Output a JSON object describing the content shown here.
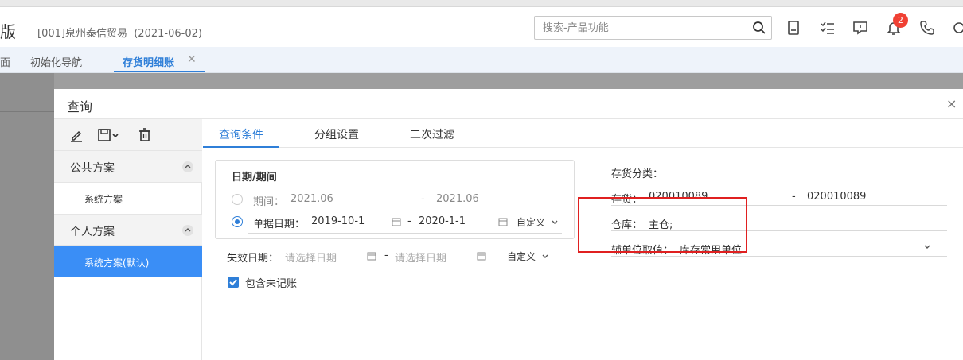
{
  "header": {
    "logo": "版",
    "company": "[001]泉州泰信贸易",
    "date": "(2021-06-02)",
    "search_placeholder": "搜索-产品功能",
    "notification_count": "2"
  },
  "tabs": [
    {
      "label": "面"
    },
    {
      "label": "初始化导航"
    },
    {
      "label": "存货明细账",
      "active": true
    }
  ],
  "dialog": {
    "title": "查询",
    "close": "×",
    "tabs": [
      {
        "label": "查询条件",
        "active": true
      },
      {
        "label": "分组设置"
      },
      {
        "label": "二次过滤"
      }
    ]
  },
  "sidebar": {
    "groups": [
      {
        "label": "公共方案",
        "items": [
          "系统方案"
        ]
      },
      {
        "label": "个人方案",
        "items": [
          "系统方案(默认)"
        ]
      }
    ]
  },
  "date_section": {
    "title": "日期/期间",
    "period_label": "期间：",
    "period_from": "2021.06",
    "period_sep": "-",
    "period_to": "2021.06",
    "doc_date_label": "单据日期：",
    "doc_date_from": "2019-10-1",
    "doc_date_sep": "-",
    "doc_date_to": "2020-1-1",
    "custom_label": "自定义",
    "period_mode": "单据日期"
  },
  "expire": {
    "label": "失效日期：",
    "from_placeholder": "请选择日期",
    "sep": "-",
    "to_placeholder": "请选择日期",
    "custom_label": "自定义"
  },
  "include_unposted": {
    "label": "包含未记账",
    "checked": true
  },
  "right_fields": {
    "category_label": "存货分类：",
    "stock_label": "存货：",
    "stock_from": "020010089",
    "stock_sep": "-",
    "stock_to": "020010089",
    "warehouse_label": "仓库：",
    "warehouse_value": "主仓;",
    "aux_unit_label": "辅单位取值：",
    "aux_unit_value": "库存常用单位"
  },
  "colors": {
    "accent": "#2f7fd8",
    "highlight": "#e02020",
    "active_bg": "#3a8ef6"
  }
}
